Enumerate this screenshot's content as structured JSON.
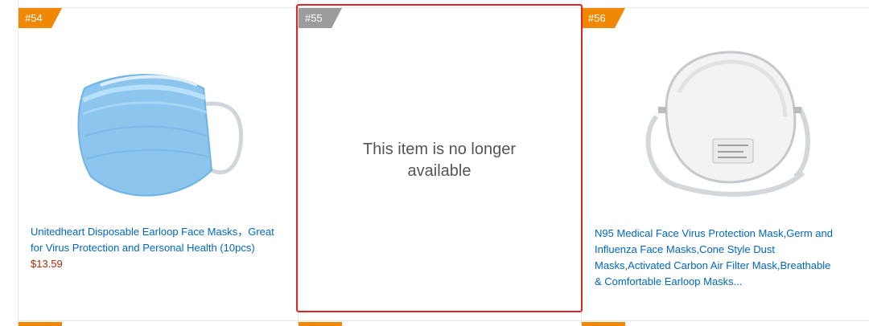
{
  "items": [
    {
      "rank": "#54",
      "title_line1": "Unitedheart Disposable Earloop Face Masks，Great",
      "title_line2": "for Virus Protection and Personal Health (10pcs)",
      "price": "$13.59",
      "image_icon": "surgical-face-mask-image",
      "available": true
    },
    {
      "rank": "#55",
      "unavailable_line1": "This item is no longer",
      "unavailable_line2": "available",
      "available": false
    },
    {
      "rank": "#56",
      "title_line1": "N95 Medical Face Virus Protection Mask,Germ and",
      "title_line2": "Influenza Face Masks,Cone Style Dust",
      "title_line3": "Masks,Activated Carbon Air Filter Mask,Breathable",
      "title_line4": "& Comfortable Earloop Masks...",
      "image_icon": "n95-respirator-mask-image",
      "available": true
    }
  ],
  "colors": {
    "badge_orange": "#f08804",
    "badge_gray": "#9c9c9c",
    "link_blue": "#0066c0",
    "price_red": "#b12704",
    "highlight_red": "#e02525"
  }
}
